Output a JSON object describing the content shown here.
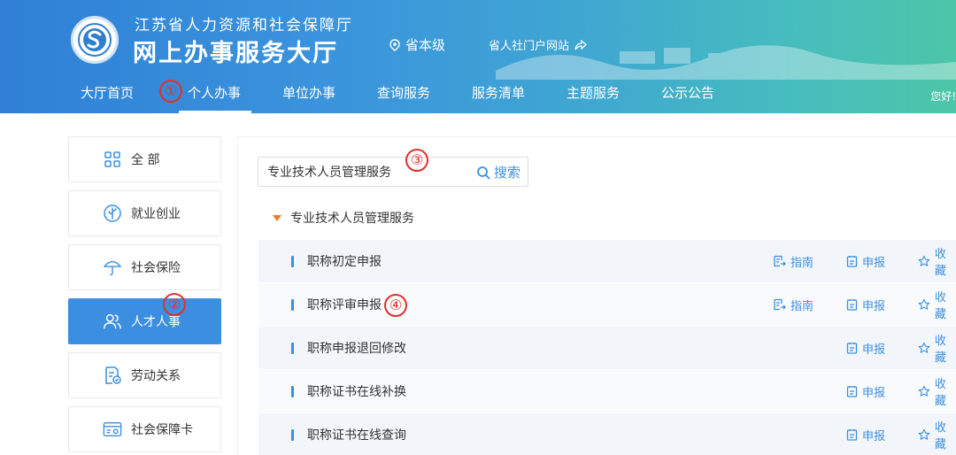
{
  "header": {
    "org_name": "江苏省人力资源和社会保障厅",
    "hall_name": "网上办事服务大厅",
    "region": "省本级",
    "portal_link": "省人社门户网站",
    "greeting": "您好!"
  },
  "nav": {
    "items": [
      {
        "label": "大厅首页"
      },
      {
        "label": "个人办事"
      },
      {
        "label": "单位办事"
      },
      {
        "label": "查询服务"
      },
      {
        "label": "服务清单"
      },
      {
        "label": "主题服务"
      },
      {
        "label": "公示公告"
      }
    ],
    "active_index": 1
  },
  "sidebar": {
    "items": [
      {
        "label": "全 部",
        "icon": "grid-icon"
      },
      {
        "label": "就业创业",
        "icon": "employment-icon"
      },
      {
        "label": "社会保险",
        "icon": "umbrella-icon"
      },
      {
        "label": "人才人事",
        "icon": "people-icon"
      },
      {
        "label": "劳动关系",
        "icon": "document-icon"
      },
      {
        "label": "社会保障卡",
        "icon": "card-icon"
      }
    ],
    "active_index": 3
  },
  "search": {
    "value": "专业技术人员管理服务",
    "button_label": "搜索"
  },
  "group": {
    "title": "专业技术人员管理服务"
  },
  "actions": {
    "guide": "指南",
    "apply": "申报",
    "favorite": "收藏"
  },
  "services": [
    {
      "title": "职称初定申报",
      "has_guide": true
    },
    {
      "title": "职称评审申报",
      "has_guide": true
    },
    {
      "title": "职称申报退回修改",
      "has_guide": false
    },
    {
      "title": "职称证书在线补换",
      "has_guide": false
    },
    {
      "title": "职称证书在线查询",
      "has_guide": false
    }
  ],
  "markers": [
    "①",
    "②",
    "③",
    "④"
  ],
  "colors": {
    "accent": "#3c8fe0",
    "marker": "#e0312b",
    "triangle": "#f07a2a"
  }
}
